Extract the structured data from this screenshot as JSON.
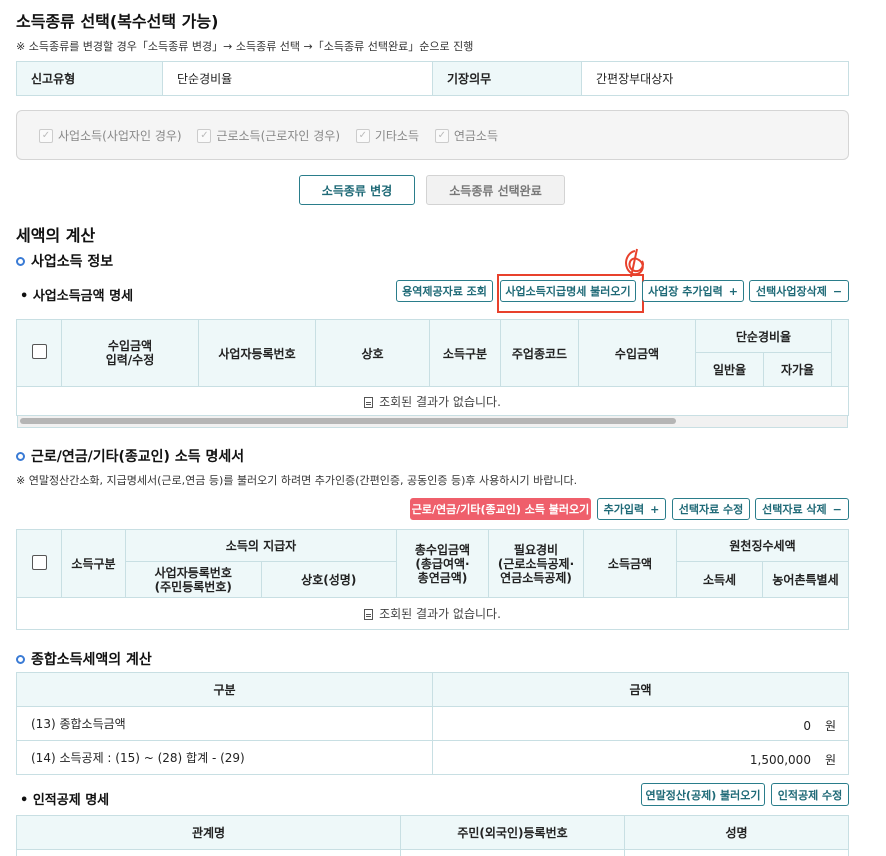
{
  "page": {
    "title": "소득종류 선택(복수선택 가능)",
    "note": "※ 소득종류를 변경할 경우「소득종류 변경」→ 소득종류 선택 →「소득종류 선택완료」순으로 진행"
  },
  "info": {
    "report_type_label": "신고유형",
    "report_type_value": "단순경비율",
    "bookkeeping_label": "기장의무",
    "bookkeeping_value": "간편장부대상자"
  },
  "income_types": [
    {
      "label": "사업소득(사업자인 경우)",
      "checked": true
    },
    {
      "label": "근로소득(근로자인 경우)",
      "checked": true
    },
    {
      "label": "기타소득",
      "checked": true
    },
    {
      "label": "연금소득",
      "checked": true
    }
  ],
  "buttons": {
    "change": "소득종류 변경",
    "complete": "소득종류 선택완료"
  },
  "tax_calc": {
    "title": "세액의 계산"
  },
  "biz": {
    "section": "사업소득 정보",
    "sub": "사업소득금액 명세",
    "btn_service": "용역제공자료 조회",
    "btn_load": "사업소득지급명세 불러오기",
    "btn_add": "사업장 추가입력",
    "btn_delete": "선택사업장삭제",
    "cols": {
      "income_edit": "수입금액\n입력/수정",
      "reg_no": "사업자등록번호",
      "name": "상호",
      "income_type": "소득구분",
      "industry_code": "주업종코드",
      "income_amount": "수입금액",
      "simple_rate": "단순경비율",
      "general_rate": "일반율",
      "self_rate": "자가율"
    },
    "empty": "조회된 결과가 없습니다."
  },
  "labor": {
    "section": "근로/연금/기타(종교인) 소득 명세서",
    "note": "※ 연말정산간소화, 지급명세서(근로,연금 등)를 불러오기 하려면 추가인증(간편인증, 공동인증 등)후 사용하시기 바랍니다.",
    "btn_load": "근로/연금/기타(종교인) 소득 불러오기",
    "btn_add": "추가입력",
    "btn_edit": "선택자료 수정",
    "btn_delete": "선택자료 삭제",
    "cols": {
      "income_type": "소득구분",
      "payer": "소득의 지급자",
      "reg_no": "사업자등록번호\n(주민등록번호)",
      "name": "상호(성명)",
      "total": "총수입금액\n(총급여액·\n총연금액)",
      "expense": "필요경비\n(근로소득공제·\n연금소득공제)",
      "income": "소득금액",
      "withholding": "원천징수세액",
      "income_tax": "소득세",
      "rural_tax": "농어촌특별세"
    },
    "empty": "조회된 결과가 없습니다."
  },
  "global": {
    "section": "종합소득세액의 계산",
    "col_type": "구분",
    "col_amount": "금액",
    "rows": [
      {
        "label": "(13) 종합소득금액",
        "value": "0",
        "unit": "원"
      },
      {
        "label": "(14) 소득공제 : (15) ~ (28) 합계 - (29)",
        "value": "1,500,000",
        "unit": "원"
      }
    ]
  },
  "personal": {
    "sub": "인적공제 명세",
    "btn_load": "연말정산(공제) 불러오기",
    "btn_edit": "인적공제 수정",
    "cols": {
      "relation": "관계명",
      "id": "주민(외국인)등록번호",
      "name": "성명"
    }
  },
  "colors": {
    "accent": "#2a7d8b",
    "header_bg": "#eef8f9",
    "highlight": "#e8412c",
    "danger_btn": "#ef5f6b"
  }
}
